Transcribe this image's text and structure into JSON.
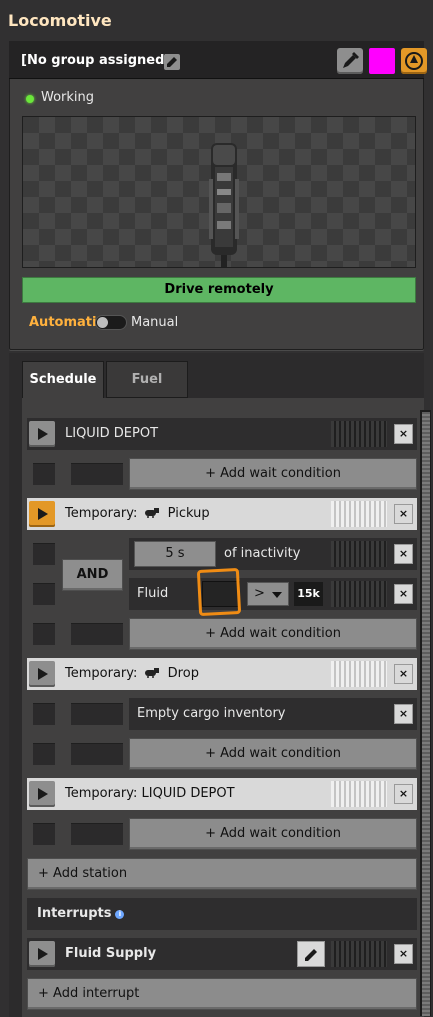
{
  "window": {
    "title": "Locomotive"
  },
  "group": {
    "label": "[No group assigned]"
  },
  "colors": {
    "train_color": "#ff00ff",
    "accent": "#e39827",
    "status_green": "#6be63b",
    "drive_green": "#5eb663"
  },
  "status": {
    "text": "Working",
    "icon": "status-dot-green"
  },
  "drive_button": {
    "label": "Drive remotely"
  },
  "mode": {
    "automatic_label": "Automatic",
    "manual_label": "Manual",
    "automatic_on": false
  },
  "tabs": [
    {
      "label": "Schedule",
      "active": true
    },
    {
      "label": "Fuel",
      "active": false
    }
  ],
  "schedule": {
    "stations": [
      {
        "name": "LIQUID DEPOT",
        "prefix": "",
        "temporary": false,
        "active": false,
        "icon": ""
      },
      {
        "name": "Pickup",
        "prefix": "Temporary:",
        "temporary": true,
        "active": true,
        "icon": "tank-icon"
      },
      {
        "name": "Drop",
        "prefix": "Temporary:",
        "temporary": true,
        "active": false,
        "icon": "tank-icon"
      },
      {
        "name": "LIQUID DEPOT",
        "prefix": "Temporary:",
        "temporary": true,
        "active": false,
        "icon": ""
      }
    ],
    "add_wait_label": "+ Add wait condition",
    "and_label": "AND",
    "conditions": {
      "inactivity": {
        "value": "5 s",
        "label": "of inactivity"
      },
      "fluid": {
        "label": "Fluid",
        "comparator": ">",
        "value": "15k"
      },
      "empty": {
        "label": "Empty cargo inventory"
      }
    },
    "close_label": "×",
    "add_station_label": "+ Add station"
  },
  "interrupts": {
    "title": "Interrupts",
    "info_icon": "i",
    "items": [
      {
        "name": "Fluid Supply"
      }
    ],
    "add_label": "+ Add interrupt"
  }
}
